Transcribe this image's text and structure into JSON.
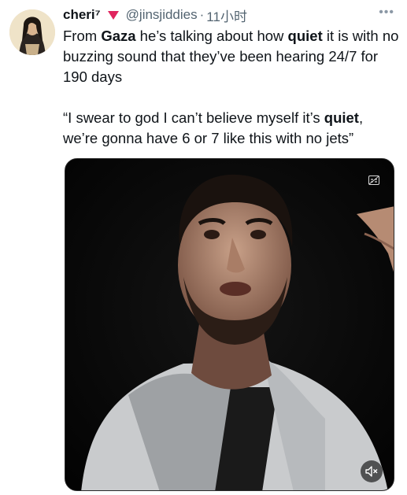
{
  "author": {
    "display_name": "cheri⁷",
    "handle": "@jinsjiddies",
    "separator": "·",
    "timestamp": "11小时"
  },
  "tweet": {
    "p1_a": "From ",
    "p1_b": "Gaza",
    "p1_c": " he’s talking about how ",
    "p1_d": "quiet",
    "p1_e": " it is with no buzzing sound that they’ve been hearing 24/7 for 190 days",
    "p2_a": "“I swear to god I can’t believe myself it’s ",
    "p2_b": "quiet",
    "p2_c": ", we’re  gonna have 6 or 7 like this with no jets”"
  },
  "icons": {
    "badge": "red-triangle-icon",
    "more": "more-options-icon",
    "captions": "captions-off-icon",
    "mute": "muted-speaker-icon"
  },
  "colors": {
    "badge": "#e0245e",
    "text": "#0f1419",
    "secondary": "#536471"
  }
}
